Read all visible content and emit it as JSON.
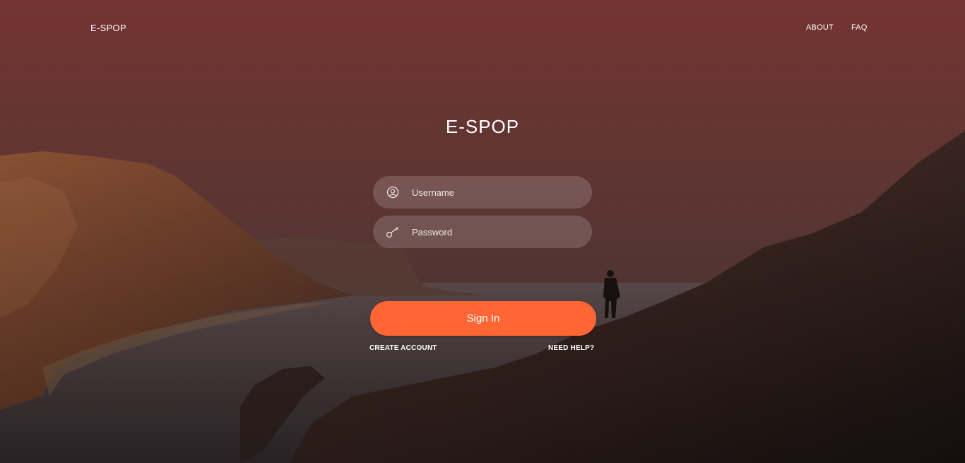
{
  "header": {
    "brand": "E-SPOP",
    "nav": [
      {
        "label": "ABOUT"
      },
      {
        "label": "FAQ"
      }
    ]
  },
  "login": {
    "title": "E-SPOP",
    "username": {
      "placeholder": "Username",
      "value": "",
      "icon": "user-icon"
    },
    "password": {
      "placeholder": "Password",
      "value": "",
      "icon": "key-icon"
    },
    "submit_label": "Sign In",
    "create_account_label": "CREATE ACCOUNT",
    "need_help_label": "NEED HELP?"
  },
  "colors": {
    "accent": "#ff6633",
    "sky_top": "#743431",
    "overlay": "#3a2422"
  }
}
